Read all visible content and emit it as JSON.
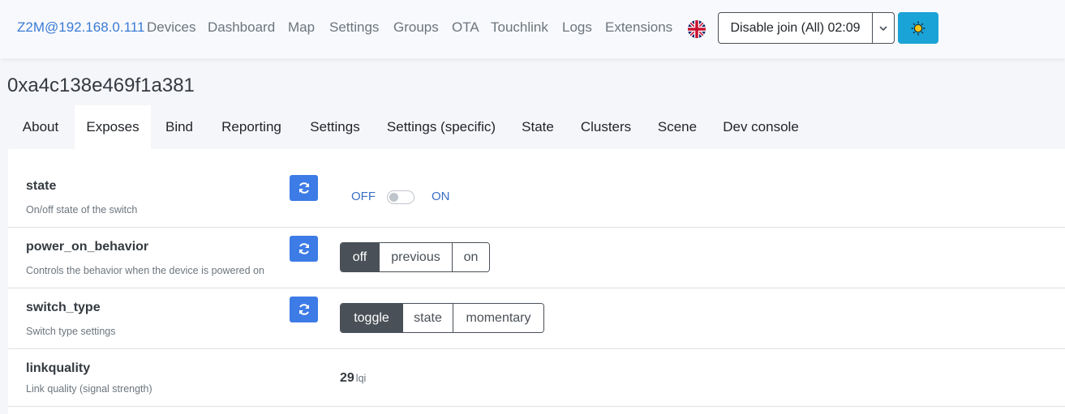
{
  "navbar": {
    "brand": "Z2M@192.168.0.111",
    "links": [
      "Devices",
      "Dashboard",
      "Map",
      "Settings",
      "Groups",
      "OTA",
      "Touchlink",
      "Logs",
      "Extensions"
    ],
    "language_icon": "uk-flag-icon",
    "permit_join_label": "Disable join (All) 02:09",
    "theme_icon": "sun-icon",
    "theme_color": "#1aa3d6"
  },
  "device": {
    "title": "0xa4c138e469f1a381"
  },
  "tabs": [
    "About",
    "Exposes",
    "Bind",
    "Reporting",
    "Settings",
    "Settings (specific)",
    "State",
    "Clusters",
    "Scene",
    "Dev console"
  ],
  "active_tab": "Exposes",
  "exposes": {
    "state": {
      "name": "state",
      "description": "On/off state of the switch",
      "off_label": "OFF",
      "on_label": "ON",
      "value": "OFF"
    },
    "power_on_behavior": {
      "name": "power_on_behavior",
      "description": "Controls the behavior when the device is powered on",
      "options": [
        "off",
        "previous",
        "on"
      ],
      "selected": "off"
    },
    "switch_type": {
      "name": "switch_type",
      "description": "Switch type settings",
      "options": [
        "toggle",
        "state",
        "momentary"
      ],
      "selected": "toggle"
    },
    "linkquality": {
      "name": "linkquality",
      "description": "Link quality (signal strength)",
      "value": "29",
      "unit": "lqi"
    }
  },
  "colors": {
    "accent_blue": "#3d7be6",
    "active_segment": "#495057"
  }
}
